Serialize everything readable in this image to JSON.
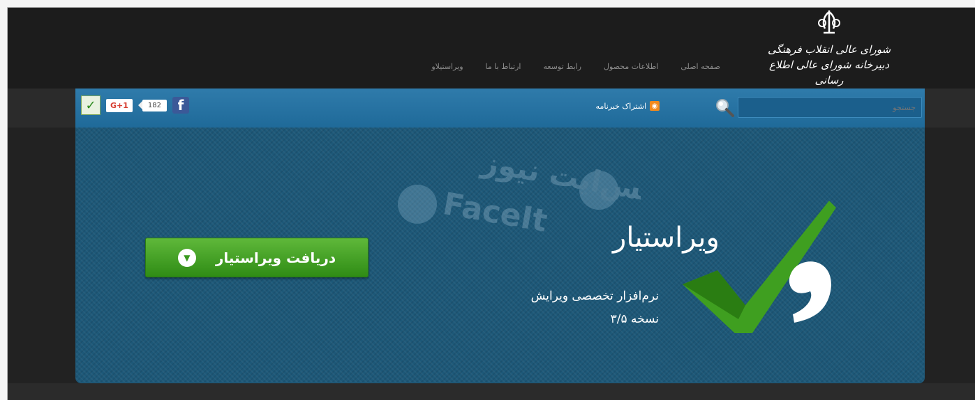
{
  "header": {
    "logo": {
      "line1": "شورای عالی انقلاب فرهنگی",
      "line2": "دبیرخانه شورای عالی اطلاع رسانی"
    },
    "nav": [
      {
        "label": "صفحه اصلی"
      },
      {
        "label": "اطلاعات محصول"
      },
      {
        "label": "رابط توسعه"
      },
      {
        "label": "ارتباط با ما"
      },
      {
        "label": "ویراستیلاو"
      }
    ]
  },
  "toolbar": {
    "search_placeholder": "جستجو",
    "rss_label": "اشتراک خبرنامه",
    "share": {
      "gplus_label": "G+1",
      "facebook_count": "182"
    }
  },
  "hero": {
    "title": "ویراستیار",
    "subtitle": "نرم‌افزار تخصصی ویرایش",
    "version": "نسخه ۳/۵",
    "download_label": "دریافت ویراستیار",
    "watermark": "فیس‌ایت نیوز FaceIt NEWS"
  },
  "colors": {
    "accent_blue": "#2f7bab",
    "hero_bg": "#1d5878",
    "button_green": "#3f9f20"
  }
}
